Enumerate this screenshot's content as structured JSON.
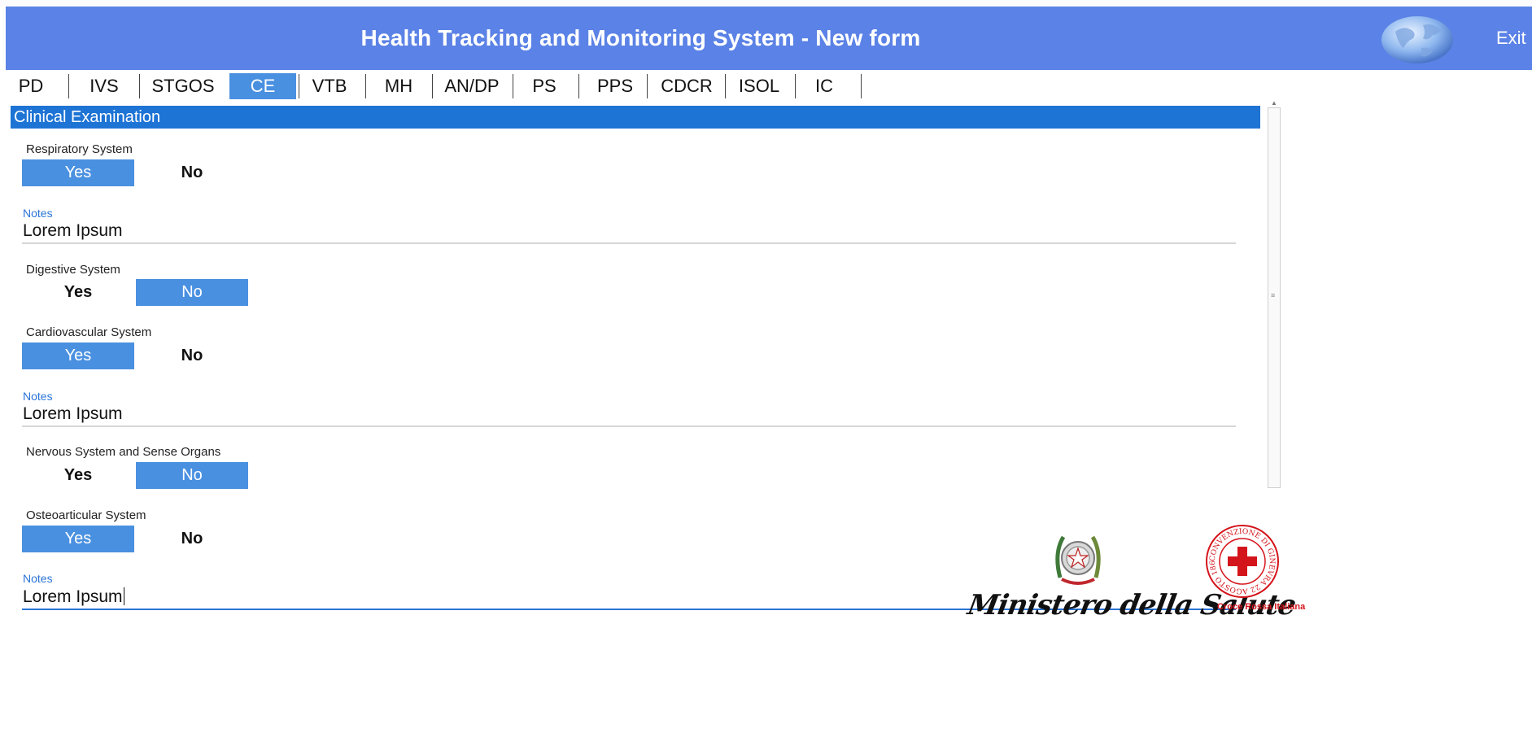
{
  "header": {
    "title": "Health Tracking and Monitoring System - New form",
    "exit_label": "Exit"
  },
  "tabs": [
    {
      "label": "PD",
      "active": false
    },
    {
      "label": "IVS",
      "active": false
    },
    {
      "label": "STGOS",
      "active": false
    },
    {
      "label": "CE",
      "active": true
    },
    {
      "label": "VTB",
      "active": false
    },
    {
      "label": "MH",
      "active": false
    },
    {
      "label": "AN/DP",
      "active": false
    },
    {
      "label": "PS",
      "active": false
    },
    {
      "label": "PPS",
      "active": false
    },
    {
      "label": "CDCR",
      "active": false
    },
    {
      "label": "ISOL",
      "active": false
    },
    {
      "label": "IC",
      "active": false
    }
  ],
  "section": {
    "title": "Clinical Examination"
  },
  "fields": {
    "respiratory": {
      "label": "Respiratory System",
      "yes": "Yes",
      "no": "No",
      "selected": "Yes",
      "notes_label": "Notes",
      "notes_value": "Lorem Ipsum"
    },
    "digestive": {
      "label": "Digestive System",
      "yes": "Yes",
      "no": "No",
      "selected": "No"
    },
    "cardiovascular": {
      "label": "Cardiovascular System",
      "yes": "Yes",
      "no": "No",
      "selected": "Yes",
      "notes_label": "Notes",
      "notes_value": "Lorem Ipsum"
    },
    "nervous": {
      "label": "Nervous System and Sense Organs",
      "yes": "Yes",
      "no": "No",
      "selected": "No"
    },
    "osteoarticular": {
      "label": "Osteoarticular System",
      "yes": "Yes",
      "no": "No",
      "selected": "Yes",
      "notes_label": "Notes",
      "notes_value": "Lorem Ipsum"
    }
  },
  "footer": {
    "ministry_logo_text": "Ministero della Salute",
    "redcross_label": "Croce Rossa Italiana",
    "redcross_seal_text": "CONVENZIONE DI GINEVRA 22 AGOSTO 1864"
  },
  "colors": {
    "header_bg": "#5b82e6",
    "accent": "#4a90e0",
    "section_bg": "#1e74d4",
    "notes_label": "#2b74d6",
    "redcross": "#d4141b"
  },
  "icons": {
    "globe": "globe-icon",
    "emblem": "italian-emblem-icon",
    "redcross": "red-cross-seal-icon"
  }
}
